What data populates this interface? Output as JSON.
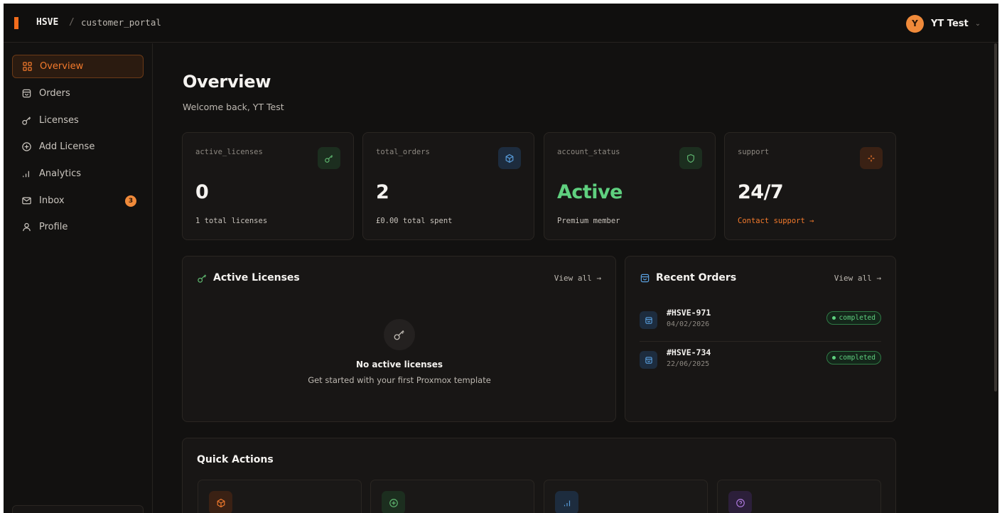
{
  "brand": {
    "name": "HSVE",
    "separator": "/",
    "project": "customer_portal"
  },
  "user": {
    "initial": "Y",
    "name": "YT Test"
  },
  "sidebar": {
    "items": [
      {
        "label": "Overview",
        "icon": "grid-icon",
        "active": true
      },
      {
        "label": "Orders",
        "icon": "shopping-bag-icon"
      },
      {
        "label": "Licenses",
        "icon": "key-icon"
      },
      {
        "label": "Add License",
        "icon": "plus-circle-icon"
      },
      {
        "label": "Analytics",
        "icon": "bar-chart-icon"
      },
      {
        "label": "Inbox",
        "icon": "mail-icon",
        "badge": "3"
      },
      {
        "label": "Profile",
        "icon": "user-icon"
      }
    ]
  },
  "page": {
    "title": "Overview",
    "subtitle": "Welcome back, YT Test"
  },
  "stats": [
    {
      "label": "active_licenses",
      "value": "0",
      "sub": "1 total licenses",
      "icon": "key-icon",
      "color": "#5fb870"
    },
    {
      "label": "total_orders",
      "value": "2",
      "sub": "£0.00 total spent",
      "icon": "box-icon",
      "color": "#5aa0e0"
    },
    {
      "label": "account_status",
      "value": "Active",
      "sub": "Premium member",
      "icon": "shield-icon",
      "color": "#5fd07f"
    },
    {
      "label": "support",
      "value": "24/7",
      "sub": "Contact support →",
      "icon": "sparkle-icon",
      "color": "#f37a2c"
    }
  ],
  "active_licenses": {
    "title": "Active Licenses",
    "view_all": "View all →",
    "empty_title": "No active licenses",
    "empty_desc": "Get started with your first Proxmox template"
  },
  "recent_orders": {
    "title": "Recent Orders",
    "view_all": "View all →",
    "orders": [
      {
        "id": "#HSVE-971",
        "date": "04/02/2026",
        "status": "completed"
      },
      {
        "id": "#HSVE-734",
        "date": "22/06/2025",
        "status": "completed"
      }
    ]
  },
  "quick_actions": {
    "title": "Quick Actions",
    "tiles": [
      {
        "icon": "box-icon",
        "color": "#f37a2c"
      },
      {
        "icon": "plus-circle-icon",
        "color": "#5fb870"
      },
      {
        "icon": "bar-chart-icon",
        "color": "#5aa0e0"
      },
      {
        "icon": "help-circle-icon",
        "color": "#b07ae0"
      }
    ]
  },
  "colors": {
    "accent": "#f37a2c",
    "success": "#5fd07f",
    "background": "#121110",
    "card": "#181615"
  }
}
